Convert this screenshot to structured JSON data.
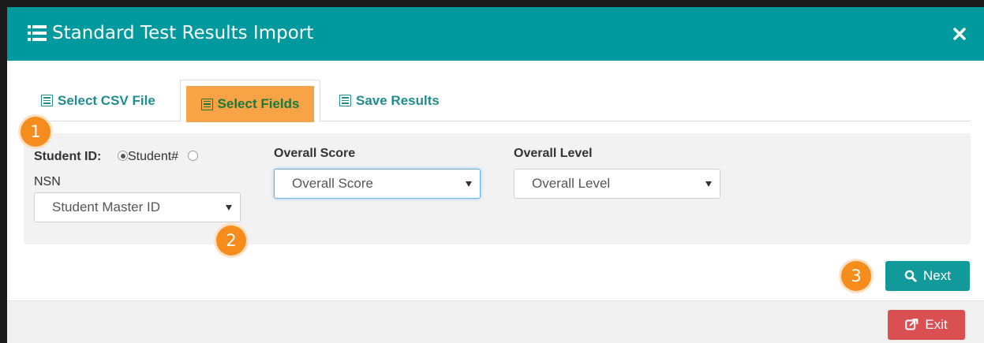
{
  "dialog": {
    "title": "Standard Test Results Import",
    "header_color": "#00999e",
    "close_icon": "times-icon"
  },
  "tabs": [
    {
      "label": "Select CSV File",
      "icon": "list-alt-icon",
      "active": false
    },
    {
      "label": "Select Fields",
      "icon": "list-alt-icon",
      "active": true
    },
    {
      "label": "Save Results",
      "icon": "list-alt-icon",
      "active": false
    }
  ],
  "fields": {
    "student_id": {
      "label": "Student ID:",
      "options": [
        {
          "label": "Student#",
          "checked": true
        },
        {
          "label": "NSN",
          "checked": false
        }
      ],
      "selected": "Student Master ID"
    },
    "overall_score": {
      "label": "Overall Score",
      "selected": "Overall Score"
    },
    "overall_level": {
      "label": "Overall Level",
      "selected": "Overall Level"
    }
  },
  "badges": [
    "1",
    "2",
    "3"
  ],
  "buttons": {
    "next": "Next",
    "exit": "Exit"
  },
  "colors": {
    "accent": "#00999e",
    "active_tab": "#f8a345",
    "badge": "#f58c1b",
    "next_button": "#12999a",
    "exit_button": "#da4f51"
  }
}
